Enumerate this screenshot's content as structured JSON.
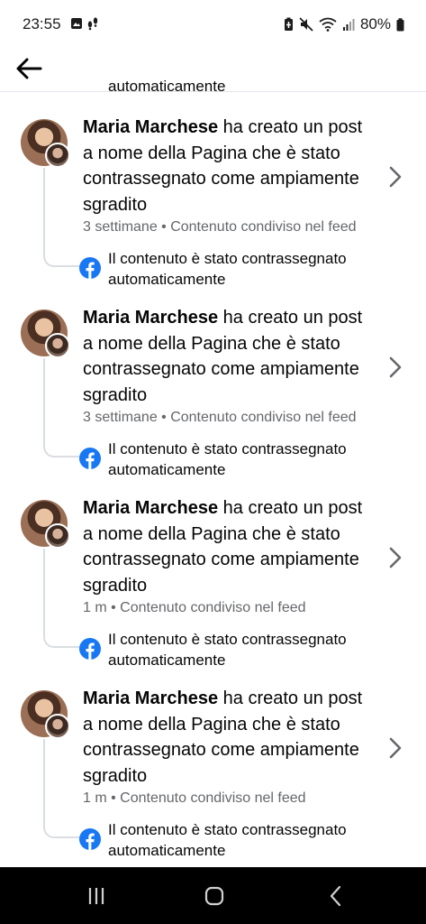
{
  "status_bar": {
    "time": "23:55",
    "battery": "80%"
  },
  "header": {
    "back_icon": "arrow-left-icon"
  },
  "clipped_previous": "automaticamente",
  "items": [
    {
      "author": "Maria Marchese",
      "action": " ha creato un post a nome della Pagina che è stato contrassegnato come ampiamente sgradito",
      "meta": "3 settimane • Contenuto condiviso nel feed",
      "flag_text": "Il contenuto è stato contrassegnato automaticamente"
    },
    {
      "author": "Maria Marchese",
      "action": " ha creato un post a nome della Pagina che è stato contrassegnato come ampiamente sgradito",
      "meta": "3 settimane • Contenuto condiviso nel feed",
      "flag_text": "Il contenuto è stato contrassegnato automaticamente"
    },
    {
      "author": "Maria Marchese",
      "action": " ha creato un post a nome della Pagina che è stato contrassegnato come ampiamente sgradito",
      "meta": "1 m • Contenuto condiviso nel feed",
      "flag_text": "Il contenuto è stato contrassegnato automaticamente"
    },
    {
      "author": "Maria Marchese",
      "action": " ha creato un post a nome della Pagina che è stato contrassegnato come ampiamente sgradito",
      "meta": "1 m • Contenuto condiviso nel feed",
      "flag_text": "Il contenuto è stato contrassegnato automaticamente"
    }
  ],
  "colors": {
    "facebook_blue": "#1877f2",
    "secondary_text": "#65676b",
    "divider": "#dadde1"
  },
  "nav_bar": {
    "icons": [
      "recent-apps-icon",
      "home-icon",
      "back-icon"
    ]
  }
}
